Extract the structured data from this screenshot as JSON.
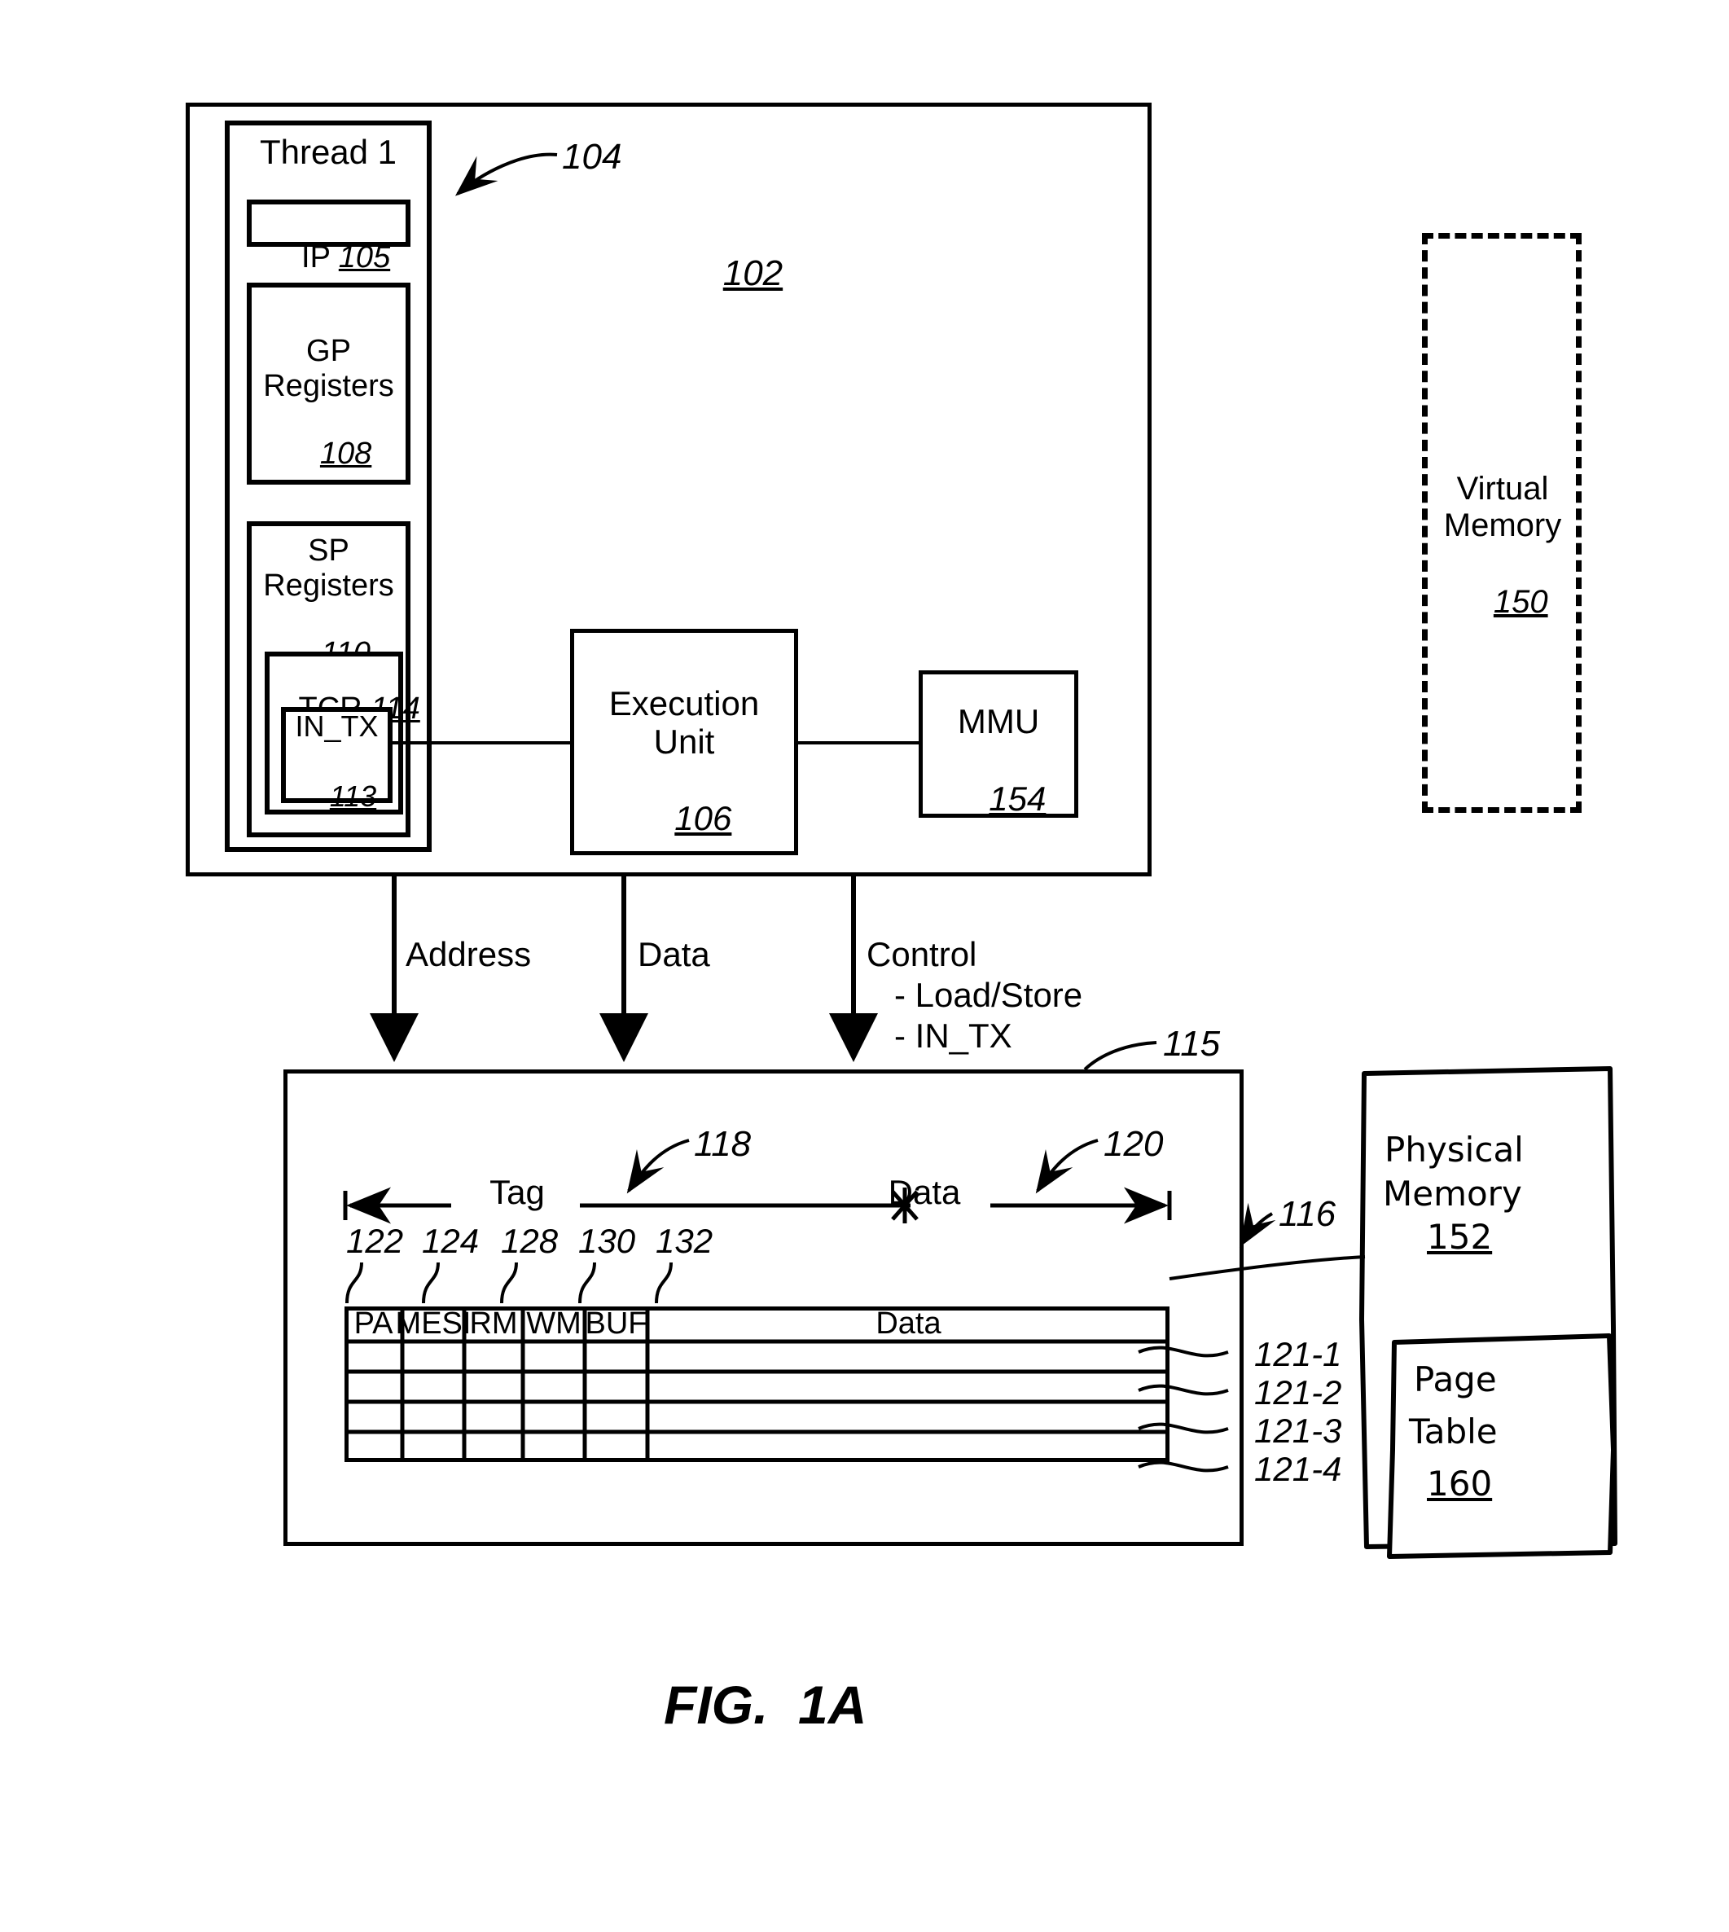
{
  "figure": {
    "caption": "FIG.  1A"
  },
  "processor": {
    "ref": "102",
    "thread": {
      "title": "Thread 1",
      "ref": "104",
      "ip": {
        "label": "IP",
        "ref": "105"
      },
      "gp_registers": {
        "label": "GP\nRegisters",
        "ref": "108"
      },
      "sp_registers": {
        "label": "SP\nRegisters",
        "ref": "110"
      },
      "tcr": {
        "label": "TCR",
        "ref": "114"
      },
      "in_tx": {
        "label": "IN_TX",
        "ref": "113"
      }
    },
    "execution_unit": {
      "label": "Execution\nUnit",
      "ref": "106"
    },
    "mmu": {
      "label": "MMU",
      "ref": "154"
    }
  },
  "virtual_memory": {
    "label": "Virtual\nMemory",
    "ref": "150"
  },
  "buses": [
    {
      "name": "Address",
      "label": "Address",
      "sublines": []
    },
    {
      "name": "Data",
      "label": "Data",
      "sublines": []
    },
    {
      "name": "Control",
      "label": "Control",
      "sublines": [
        "- Load/Store",
        "- IN_TX"
      ]
    }
  ],
  "cache": {
    "ref": "115",
    "array_ref": "116",
    "spans": [
      {
        "label": "Tag",
        "ref": "118"
      },
      {
        "label": "Data",
        "ref": "120"
      }
    ],
    "column_refs": [
      "122",
      "124",
      "128",
      "130",
      "132"
    ],
    "columns": [
      "PA",
      "MESI",
      "RM",
      "WM",
      "BUF"
    ],
    "data_column": "Data",
    "row_refs": [
      "121-1",
      "121-2",
      "121-3",
      "121-4"
    ],
    "rows": [
      {
        "PA": "",
        "MESI": "",
        "RM": "",
        "WM": "",
        "BUF": "",
        "Data": ""
      },
      {
        "PA": "",
        "MESI": "",
        "RM": "",
        "WM": "",
        "BUF": "",
        "Data": ""
      },
      {
        "PA": "",
        "MESI": "",
        "RM": "",
        "WM": "",
        "BUF": "",
        "Data": ""
      },
      {
        "PA": "",
        "MESI": "",
        "RM": "",
        "WM": "",
        "BUF": "",
        "Data": ""
      }
    ]
  },
  "physical_memory": {
    "line1": "Physical",
    "line2": "Memory",
    "ref": "152",
    "page_table": {
      "line1": "Page",
      "line2": "Table",
      "ref": "160"
    }
  }
}
